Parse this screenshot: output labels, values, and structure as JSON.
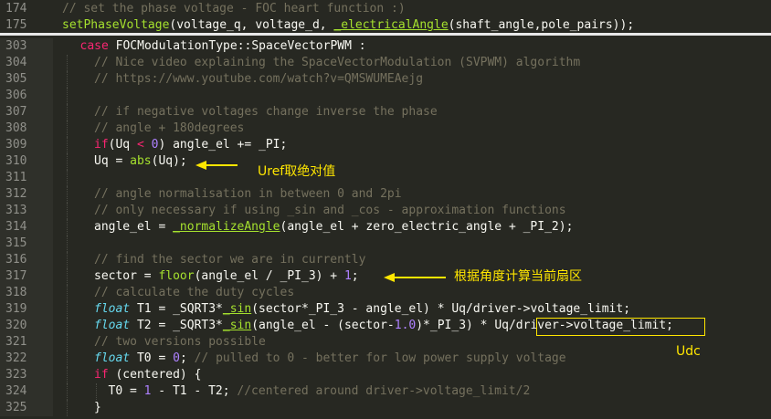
{
  "top_lines": [
    {
      "no": "174",
      "tokens": [
        [
          "cm",
          "// set the phase voltage - FOC heart function :)"
        ]
      ]
    },
    {
      "no": "175",
      "tokens": [
        [
          "fn",
          "setPhaseVoltage"
        ],
        [
          "pl",
          "(voltage_q, voltage_d, "
        ],
        [
          "ulfn",
          "_electricalAngle"
        ],
        [
          "pl",
          "(shaft_angle,pole_pairs));"
        ]
      ]
    }
  ],
  "lines": [
    {
      "no": "303",
      "indent": 1,
      "tokens": [
        [
          "kw",
          "case"
        ],
        [
          "pl",
          " FOCModulationType::SpaceVectorPWM :"
        ]
      ]
    },
    {
      "no": "304",
      "indent": 2,
      "tokens": [
        [
          "cm",
          "// Nice video explaining the SpaceVectorModulation (SVPWM) algorithm"
        ]
      ]
    },
    {
      "no": "305",
      "indent": 2,
      "tokens": [
        [
          "cm",
          "// https://www.youtube.com/watch?v=QMSWUMEAejg"
        ]
      ]
    },
    {
      "no": "306",
      "indent": 0,
      "tokens": []
    },
    {
      "no": "307",
      "indent": 2,
      "tokens": [
        [
          "cm",
          "// if negative voltages change inverse the phase"
        ]
      ]
    },
    {
      "no": "308",
      "indent": 2,
      "tokens": [
        [
          "cm",
          "// angle + 180degrees"
        ]
      ]
    },
    {
      "no": "309",
      "indent": 2,
      "tokens": [
        [
          "kw",
          "if"
        ],
        [
          "pl",
          "(Uq "
        ],
        [
          "kw",
          "<"
        ],
        [
          "pl",
          " "
        ],
        [
          "num",
          "0"
        ],
        [
          "pl",
          ") angle_el += _PI;"
        ]
      ]
    },
    {
      "no": "310",
      "indent": 2,
      "tokens": [
        [
          "pl",
          "Uq = "
        ],
        [
          "fn",
          "abs"
        ],
        [
          "pl",
          "(Uq);"
        ]
      ]
    },
    {
      "no": "311",
      "indent": 0,
      "tokens": []
    },
    {
      "no": "312",
      "indent": 2,
      "tokens": [
        [
          "cm",
          "// angle normalisation in between 0 and 2pi"
        ]
      ]
    },
    {
      "no": "313",
      "indent": 2,
      "tokens": [
        [
          "cm",
          "// only necessary if using _sin and _cos - approximation functions"
        ]
      ]
    },
    {
      "no": "314",
      "indent": 2,
      "tokens": [
        [
          "pl",
          "angle_el = "
        ],
        [
          "ulfn",
          "_normalizeAngle"
        ],
        [
          "pl",
          "(angle_el + zero_electric_angle + _PI_2);"
        ]
      ]
    },
    {
      "no": "315",
      "indent": 0,
      "tokens": []
    },
    {
      "no": "316",
      "indent": 2,
      "tokens": [
        [
          "cm",
          "// find the sector we are in currently"
        ]
      ]
    },
    {
      "no": "317",
      "indent": 2,
      "tokens": [
        [
          "pl",
          "sector = "
        ],
        [
          "fn",
          "floor"
        ],
        [
          "pl",
          "(angle_el / _PI_3) + "
        ],
        [
          "num",
          "1"
        ],
        [
          "pl",
          ";"
        ]
      ]
    },
    {
      "no": "318",
      "indent": 2,
      "tokens": [
        [
          "cm",
          "// calculate the duty cycles"
        ]
      ]
    },
    {
      "no": "319",
      "indent": 2,
      "tokens": [
        [
          "type",
          "float"
        ],
        [
          "pl",
          " T1 = _SQRT3*"
        ],
        [
          "ulfn",
          "_sin"
        ],
        [
          "pl",
          "(sector*_PI_3 - angle_el) * Uq/driver->voltage_limit;"
        ]
      ]
    },
    {
      "no": "320",
      "indent": 2,
      "tokens": [
        [
          "type",
          "float"
        ],
        [
          "pl",
          " T2 = _SQRT3*"
        ],
        [
          "ulfn",
          "_sin"
        ],
        [
          "pl",
          "(angle_el - (sector-"
        ],
        [
          "num",
          "1.0"
        ],
        [
          "pl",
          ")*_PI_3) * Uq/driver->voltage_limit;"
        ]
      ]
    },
    {
      "no": "321",
      "indent": 2,
      "tokens": [
        [
          "cm",
          "// two versions possible"
        ]
      ]
    },
    {
      "no": "322",
      "indent": 2,
      "tokens": [
        [
          "type",
          "float"
        ],
        [
          "pl",
          " T0 = "
        ],
        [
          "num",
          "0"
        ],
        [
          "pl",
          "; "
        ],
        [
          "cm",
          "// pulled to 0 - better for low power supply voltage"
        ]
      ]
    },
    {
      "no": "323",
      "indent": 2,
      "tokens": [
        [
          "kw",
          "if"
        ],
        [
          "pl",
          " (centered) {"
        ]
      ]
    },
    {
      "no": "324",
      "indent": 3,
      "tokens": [
        [
          "pl",
          "T0 = "
        ],
        [
          "num",
          "1"
        ],
        [
          "pl",
          " - T1 - T2; "
        ],
        [
          "cm",
          "//centered around driver->voltage_limit/2"
        ]
      ]
    },
    {
      "no": "325",
      "indent": 2,
      "tokens": [
        [
          "pl",
          "}"
        ]
      ]
    }
  ],
  "annotations": {
    "uref": "Uref取绝对值",
    "sector": "根据角度计算当前扇区",
    "udc": "Udc"
  },
  "colors": {
    "background": "#272822",
    "annotation": "#ffe600",
    "comment": "#75715e",
    "keyword": "#f92672",
    "function": "#a6e22e",
    "number": "#ae81ff",
    "type": "#66d9ef"
  }
}
